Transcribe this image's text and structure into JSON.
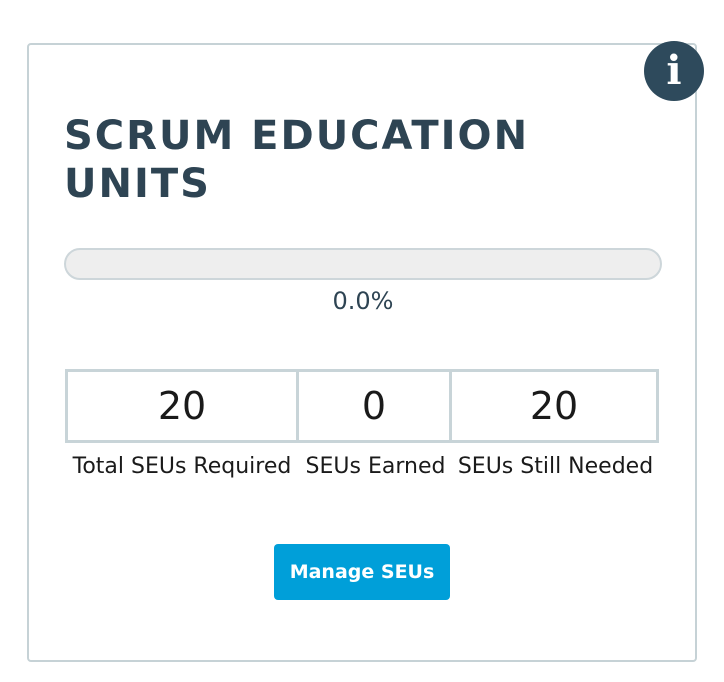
{
  "card": {
    "title": "SCRUM EDUCATION UNITS",
    "info_icon": "info-icon",
    "info_label": "i"
  },
  "progress": {
    "value_fraction": 0.0,
    "label": "0.0%",
    "fill_color": "#00a0d6",
    "track_color": "#eeeeee"
  },
  "stats": [
    {
      "value": "20",
      "label": "Total SEUs Required"
    },
    {
      "value": "0",
      "label": "SEUs Earned"
    },
    {
      "value": "20",
      "label": "SEUs Still Needed"
    }
  ],
  "actions": {
    "manage_label": "Manage SEUs",
    "manage_color": "#009fd9"
  },
  "colors": {
    "title": "#2e4453",
    "info_bg": "#2e4a5c",
    "border": "#c6d2d6"
  }
}
